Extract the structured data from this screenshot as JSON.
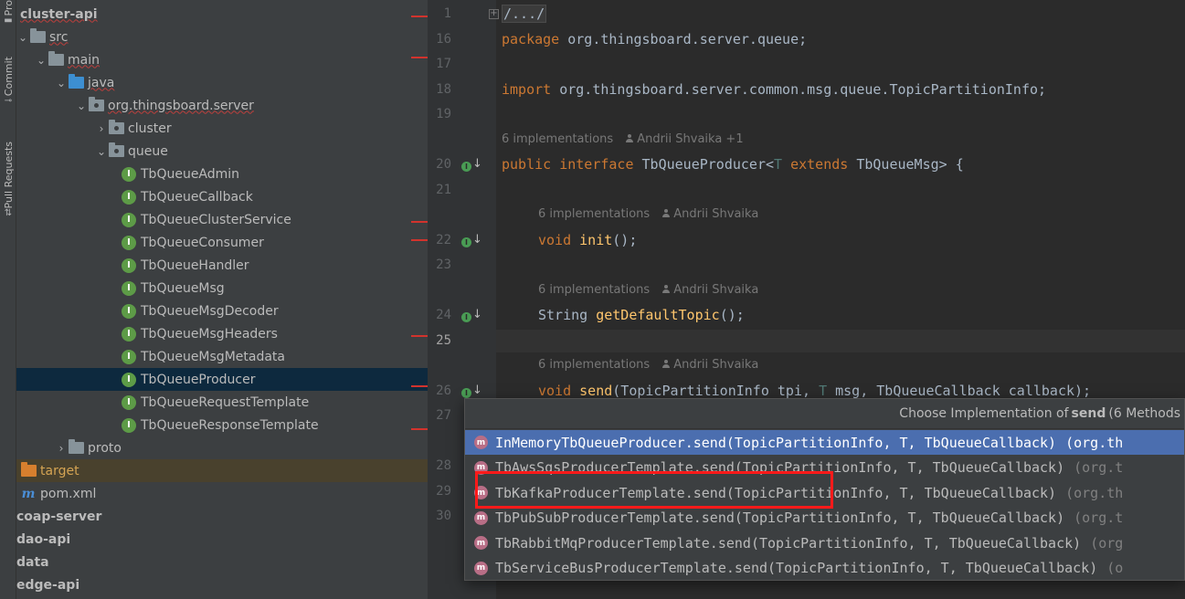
{
  "toolstrip": {
    "tabs": [
      {
        "label": "Pro",
        "icon": "folder-icon"
      },
      {
        "label": "Commit",
        "icon": "commit-icon"
      },
      {
        "label": "Pull Requests",
        "icon": "pull-request-icon"
      }
    ]
  },
  "tree": {
    "items": [
      {
        "label": "cluster-api",
        "level": 0,
        "chevron": "",
        "icon": "module",
        "bold": true
      },
      {
        "label": "src",
        "level": 0,
        "chevron": "down",
        "icon": "folder-gray"
      },
      {
        "label": "main",
        "level": 1,
        "chevron": "down",
        "icon": "folder-gray"
      },
      {
        "label": "java",
        "level": 2,
        "chevron": "down",
        "icon": "folder-blue"
      },
      {
        "label": "org.thingsboard.server",
        "level": 3,
        "chevron": "down",
        "icon": "package"
      },
      {
        "label": "cluster",
        "level": 4,
        "chevron": "right",
        "icon": "package"
      },
      {
        "label": "queue",
        "level": 4,
        "chevron": "down",
        "icon": "package"
      },
      {
        "label": "TbQueueAdmin",
        "level": 5,
        "chevron": "",
        "icon": "interface"
      },
      {
        "label": "TbQueueCallback",
        "level": 5,
        "chevron": "",
        "icon": "interface"
      },
      {
        "label": "TbQueueClusterService",
        "level": 5,
        "chevron": "",
        "icon": "interface"
      },
      {
        "label": "TbQueueConsumer",
        "level": 5,
        "chevron": "",
        "icon": "interface"
      },
      {
        "label": "TbQueueHandler",
        "level": 5,
        "chevron": "",
        "icon": "interface"
      },
      {
        "label": "TbQueueMsg",
        "level": 5,
        "chevron": "",
        "icon": "interface"
      },
      {
        "label": "TbQueueMsgDecoder",
        "level": 5,
        "chevron": "",
        "icon": "interface"
      },
      {
        "label": "TbQueueMsgHeaders",
        "level": 5,
        "chevron": "",
        "icon": "interface"
      },
      {
        "label": "TbQueueMsgMetadata",
        "level": 5,
        "chevron": "",
        "icon": "interface"
      },
      {
        "label": "TbQueueProducer",
        "level": 5,
        "chevron": "",
        "icon": "interface",
        "selected": true
      },
      {
        "label": "TbQueueRequestTemplate",
        "level": 5,
        "chevron": "",
        "icon": "interface"
      },
      {
        "label": "TbQueueResponseTemplate",
        "level": 5,
        "chevron": "",
        "icon": "interface"
      },
      {
        "label": "proto",
        "level": 2,
        "chevron": "right",
        "icon": "folder-gray"
      },
      {
        "label": "target",
        "level": 0,
        "chevron": "",
        "icon": "folder-orange",
        "excluded": true
      },
      {
        "label": "pom.xml",
        "level": 0,
        "chevron": "",
        "icon": "maven"
      },
      {
        "label": "coap-server",
        "level": -1,
        "chevron": "",
        "icon": "module",
        "bold": true
      },
      {
        "label": "dao-api",
        "level": -1,
        "chevron": "",
        "icon": "module",
        "bold": true
      },
      {
        "label": "data",
        "level": -1,
        "chevron": "",
        "icon": "module",
        "bold": true
      },
      {
        "label": "edge-api",
        "level": -1,
        "chevron": "",
        "icon": "module",
        "bold": true
      }
    ]
  },
  "editor": {
    "current_line": "25",
    "lines": [
      {
        "num": "1",
        "kind": "fold",
        "text": "/.../"
      },
      {
        "num": "16",
        "kind": "package",
        "kw": "package",
        "rest": " org.thingsboard.server.queue;"
      },
      {
        "num": "17",
        "kind": "blank"
      },
      {
        "num": "18",
        "kind": "import",
        "kw": "import",
        "rest": " org.thingsboard.server.common.msg.queue.TopicPartitionInfo;"
      },
      {
        "num": "19",
        "kind": "blank"
      },
      {
        "num": "20",
        "kind": "interface"
      },
      {
        "num": "21",
        "kind": "blank"
      },
      {
        "num": "22",
        "kind": "init"
      },
      {
        "num": "23",
        "kind": "blank"
      },
      {
        "num": "24",
        "kind": "topic"
      },
      {
        "num": "25",
        "kind": "blank"
      },
      {
        "num": "26",
        "kind": "send"
      },
      {
        "num": "27",
        "kind": "blank"
      },
      {
        "num": "28",
        "kind": "blank"
      },
      {
        "num": "29",
        "kind": "blank"
      },
      {
        "num": "30",
        "kind": "blank"
      }
    ],
    "hints": [
      {
        "count": "6 implementations",
        "author": "Andrii Shvaika +1"
      },
      {
        "count": "6 implementations",
        "author": "Andrii Shvaika"
      },
      {
        "count": "6 implementations",
        "author": "Andrii Shvaika"
      },
      {
        "count": "6 implementations",
        "author": "Andrii Shvaika"
      }
    ],
    "code": {
      "interface_kw1": "public",
      "interface_kw2": "interface",
      "interface_name": " TbQueueProducer<",
      "interface_tp": "T",
      "interface_ext": "extends",
      "interface_rest": " TbQueueMsg> {",
      "init_kw": "void",
      "init_fn": "init",
      "init_rest": "();",
      "topic_type": "String ",
      "topic_fn": "getDefaultTopic",
      "topic_rest": "();",
      "send_kw": "void",
      "send_fn": "send",
      "send_a": "(TopicPartitionInfo tpi, ",
      "send_tp": "T",
      "send_b": " msg, TbQueueCallback callback);"
    }
  },
  "popup": {
    "title_prefix": "Choose Implementation of",
    "title_method": "send",
    "title_suffix": "(6 Methods",
    "items": [
      {
        "text": "InMemoryTbQueueProducer.send(TopicPartitionInfo, T, TbQueueCallback)",
        "loc": "(org.th",
        "selected": true
      },
      {
        "text": "TbAwsSqsProducerTemplate.send(TopicPartitionInfo, T, TbQueueCallback)",
        "loc": "(org.t"
      },
      {
        "text": "TbKafkaProducerTemplate.send(TopicPartitionInfo, T, TbQueueCallback)",
        "loc": "(org.th"
      },
      {
        "text": "TbPubSubProducerTemplate.send(TopicPartitionInfo, T, TbQueueCallback)",
        "loc": "(org.t"
      },
      {
        "text": "TbRabbitMqProducerTemplate.send(TopicPartitionInfo, T, TbQueueCallback)",
        "loc": "(org"
      },
      {
        "text": "TbServiceBusProducerTemplate.send(TopicPartitionInfo, T, TbQueueCallback)",
        "loc": "(o"
      }
    ],
    "badge": "m"
  },
  "colors": {
    "annotation": "#ff1a1a",
    "selection": "#4b6eaf",
    "tree_selection": "#0d293e"
  }
}
